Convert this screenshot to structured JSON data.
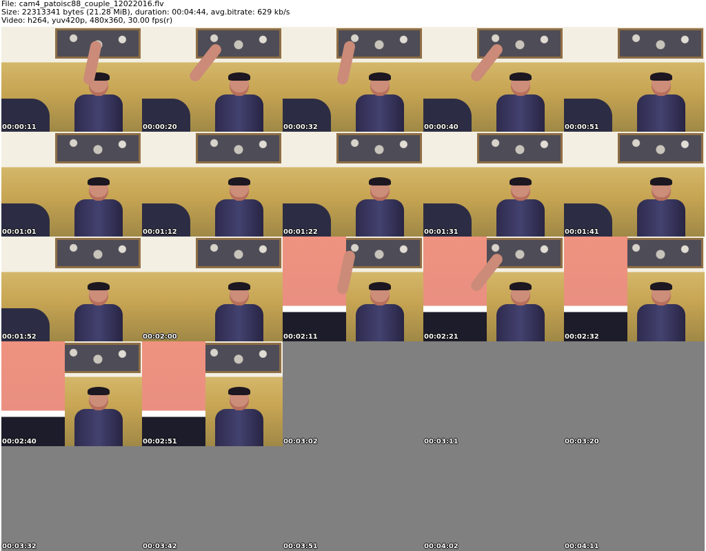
{
  "header": {
    "file_line": "File: cam4_patoisc88_couple_12022016.flv",
    "size_line": "Size: 22313341 bytes (21.28 MiB), duration: 00:04:44, avg.bitrate: 629 kb/s",
    "video_line": "Video: h264, yuv420p, 480x360, 30.00 fps(r)"
  },
  "frames": [
    {
      "time": "00:00:11",
      "has_image": true
    },
    {
      "time": "00:00:20",
      "has_image": true
    },
    {
      "time": "00:00:32",
      "has_image": true
    },
    {
      "time": "00:00:40",
      "has_image": true
    },
    {
      "time": "00:00:51",
      "has_image": true
    },
    {
      "time": "00:01:01",
      "has_image": true
    },
    {
      "time": "00:01:12",
      "has_image": true
    },
    {
      "time": "00:01:22",
      "has_image": true
    },
    {
      "time": "00:01:31",
      "has_image": true
    },
    {
      "time": "00:01:41",
      "has_image": true
    },
    {
      "time": "00:01:52",
      "has_image": true
    },
    {
      "time": "00:02:00",
      "has_image": true
    },
    {
      "time": "00:02:11",
      "has_image": true
    },
    {
      "time": "00:02:21",
      "has_image": true
    },
    {
      "time": "00:02:32",
      "has_image": true
    },
    {
      "time": "00:02:40",
      "has_image": true
    },
    {
      "time": "00:02:51",
      "has_image": true
    },
    {
      "time": "00:03:02",
      "has_image": false
    },
    {
      "time": "00:03:11",
      "has_image": false
    },
    {
      "time": "00:03:20",
      "has_image": false
    },
    {
      "time": "00:03:32",
      "has_image": false
    },
    {
      "time": "00:03:42",
      "has_image": false
    },
    {
      "time": "00:03:51",
      "has_image": false
    },
    {
      "time": "00:04:02",
      "has_image": false
    },
    {
      "time": "00:04:11",
      "has_image": false
    }
  ]
}
